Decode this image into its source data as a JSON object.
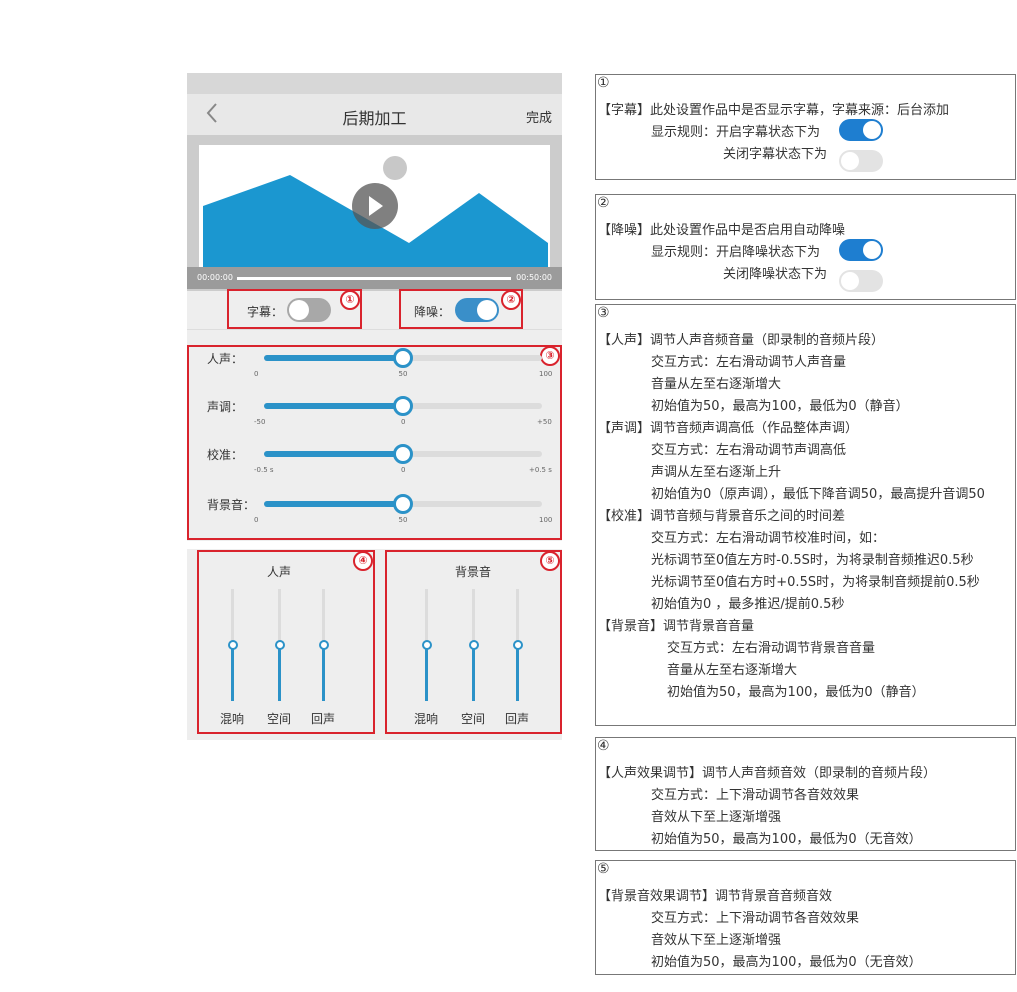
{
  "nav": {
    "title": "后期加工",
    "done": "完成"
  },
  "video": {
    "start_time": "00:00:00",
    "end_time": "00:50:00",
    "progress": 0
  },
  "toggles": {
    "subtitle": {
      "label": "字幕：",
      "on": false,
      "marker": "①"
    },
    "denoise": {
      "label": "降噪：",
      "on": true,
      "marker": "②"
    }
  },
  "sliders": {
    "marker": "③",
    "items": [
      {
        "label": "人声：",
        "ticks": [
          "0",
          "50",
          "100"
        ],
        "value": 50,
        "min": 0,
        "max": 100
      },
      {
        "label": "声调：",
        "ticks": [
          "-50",
          "0",
          "+50"
        ],
        "value": 0,
        "min": -50,
        "max": 50
      },
      {
        "label": "校准：",
        "ticks": [
          "-0.5 s",
          "0",
          "+0.5 s"
        ],
        "value": 0,
        "min": -0.5,
        "max": 0.5
      },
      {
        "label": "背景音：",
        "ticks": [
          "0",
          "50",
          "100"
        ],
        "value": 50,
        "min": 0,
        "max": 100
      }
    ]
  },
  "eq": {
    "voice": {
      "title": "人声",
      "marker": "④",
      "bands": [
        {
          "label": "混响",
          "value": 50
        },
        {
          "label": "空间",
          "value": 50
        },
        {
          "label": "回声",
          "value": 50
        }
      ]
    },
    "background": {
      "title": "背景音",
      "marker": "⑤",
      "bands": [
        {
          "label": "混响",
          "value": 50
        },
        {
          "label": "空间",
          "value": 50
        },
        {
          "label": "回声",
          "value": 50
        }
      ]
    }
  },
  "annotations": {
    "a1": {
      "num": "①",
      "l1": "【字幕】此处设置作品中是否显示字幕，字幕来源：后台添加",
      "l2": "显示规则：开启字幕状态下为",
      "l3": "关闭字幕状态下为"
    },
    "a2": {
      "num": "②",
      "l1": "【降噪】此处设置作品中是否启用自动降噪",
      "l2": "显示规则：开启降噪状态下为",
      "l3": "关闭降噪状态下为"
    },
    "a3": {
      "num": "③",
      "lines": [
        "【人声】调节人声音频音量（即录制的音频片段）",
        "交互方式：左右滑动调节人声音量",
        "音量从左至右逐渐增大",
        "初始值为50，最高为100，最低为0（静音）",
        "【声调】调节音频声调高低（作品整体声调）",
        "交互方式：左右滑动调节声调高低",
        "声调从左至右逐渐上升",
        "初始值为0（原声调），最低下降音调50，最高提升音调50",
        "【校准】调节音频与背景音乐之间的时间差",
        "交互方式：左右滑动调节校准时间，如：",
        "光标调节至0值左方时-0.5S时，为将录制音频推迟0.5秒",
        "光标调节至0值右方时+0.5S时，为将录制音频提前0.5秒",
        "初始值为0 ，最多推迟/提前0.5秒",
        "【背景音】调节背景音音量",
        "交互方式：左右滑动调节背景音音量",
        "音量从左至右逐渐增大",
        "初始值为50，最高为100，最低为0（静音）"
      ]
    },
    "a4": {
      "num": "④",
      "lines": [
        "【人声效果调节】调节人声音频音效（即录制的音频片段）",
        "交互方式：上下滑动调节各音效效果",
        "音效从下至上逐渐增强",
        "初始值为50，最高为100，最低为0（无音效）"
      ]
    },
    "a5": {
      "num": "⑤",
      "lines": [
        "【背景音效果调节】调节背景音音频音效",
        "交互方式：上下滑动调节各音效效果",
        "音效从下至上逐渐增强",
        "初始值为50，最高为100，最低为0（无音效）"
      ]
    }
  },
  "colors": {
    "accent": "#2b92c8",
    "marker": "#d9232d",
    "mountain": "#1b97d0"
  },
  "icons": {
    "back": "chevron-left-icon",
    "play": "play-icon"
  }
}
